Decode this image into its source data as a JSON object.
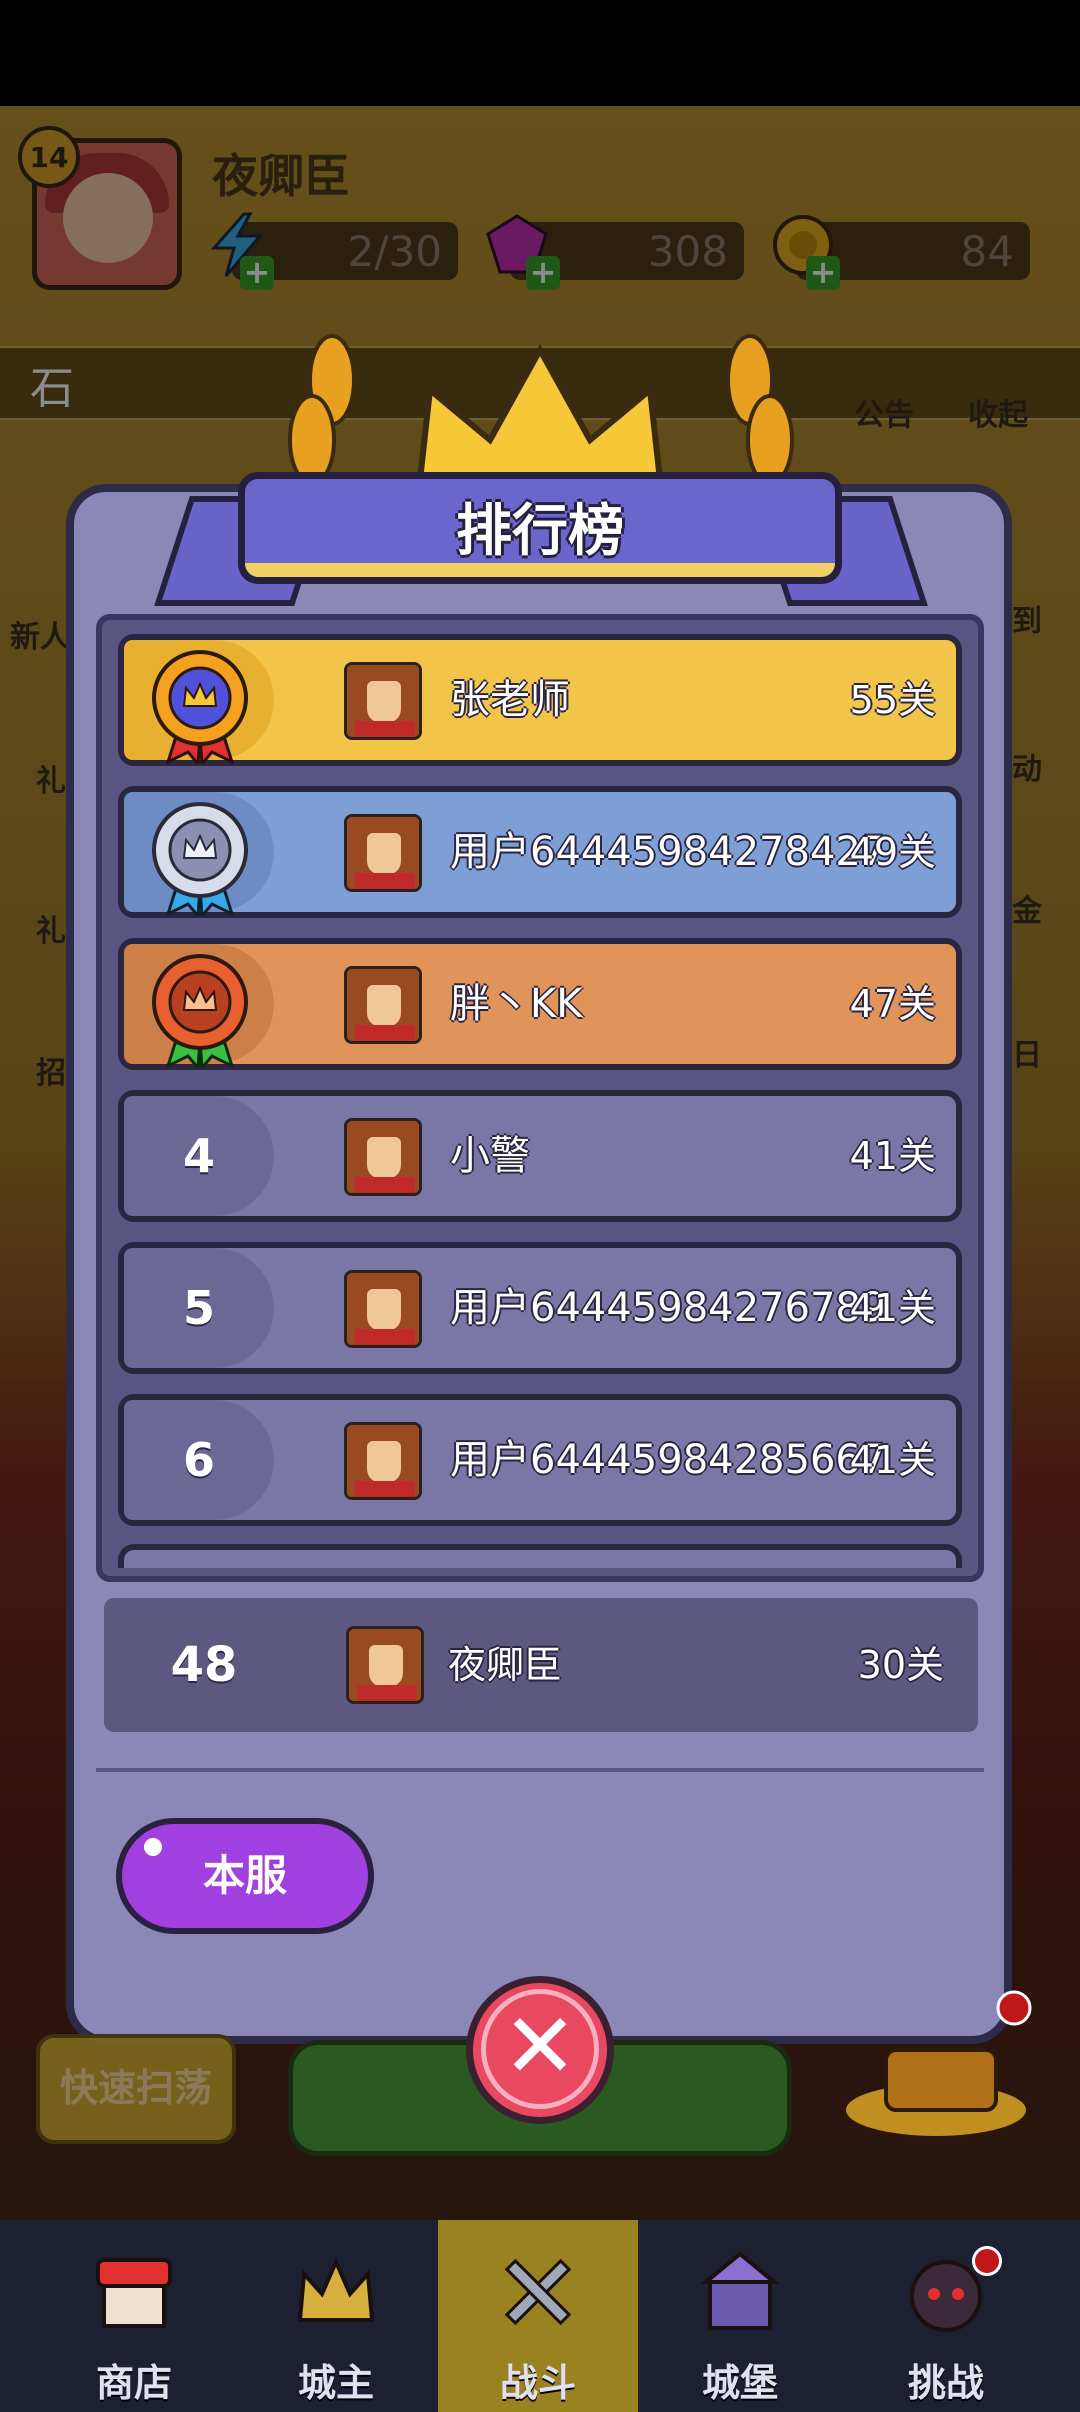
{
  "hud": {
    "level": "14",
    "player_name": "夜卿臣",
    "energy": "2/30",
    "gems": "308",
    "coins": "84",
    "search_text": "石"
  },
  "top_icons": {
    "notice": "公告",
    "collapse": "收起"
  },
  "edge_labels": {
    "new_player": "新人",
    "right_1": "到",
    "right_2": "动",
    "right_3": "金",
    "right_4": "日",
    "left_1": "礼",
    "left_2": "礼",
    "left_3": "招"
  },
  "dialog": {
    "title": "排行榜"
  },
  "leaderboard": [
    {
      "rank": "1",
      "name": "张老师",
      "score": "55关",
      "medal": "gold"
    },
    {
      "rank": "2",
      "name": "用户64445984278427",
      "score": "49关",
      "medal": "silver"
    },
    {
      "rank": "3",
      "name": "胖丶KK",
      "score": "47关",
      "medal": "bronze"
    },
    {
      "rank": "4",
      "name": "小警",
      "score": "41关"
    },
    {
      "rank": "5",
      "name": "用户64445984276789",
      "score": "41关"
    },
    {
      "rank": "6",
      "name": "用户64445984285667",
      "score": "41关"
    }
  ],
  "my_rank": {
    "rank": "48",
    "name": "夜卿臣",
    "score": "30关"
  },
  "tabs": {
    "server": "本服"
  },
  "buttons": {
    "quick_sweep": "快速扫荡"
  },
  "bottom_nav": [
    {
      "label": "商店"
    },
    {
      "label": "城主"
    },
    {
      "label": "战斗"
    },
    {
      "label": "城堡"
    },
    {
      "label": "挑战"
    }
  ],
  "colors": {
    "gold_row": "#f2c44a",
    "silver_row": "#7e9ed6",
    "bronze_row": "#e0945a",
    "normal_row": "#7a76a6",
    "dialog": "#8b88b8",
    "close": "#e84860",
    "tab": "#a040e0"
  }
}
